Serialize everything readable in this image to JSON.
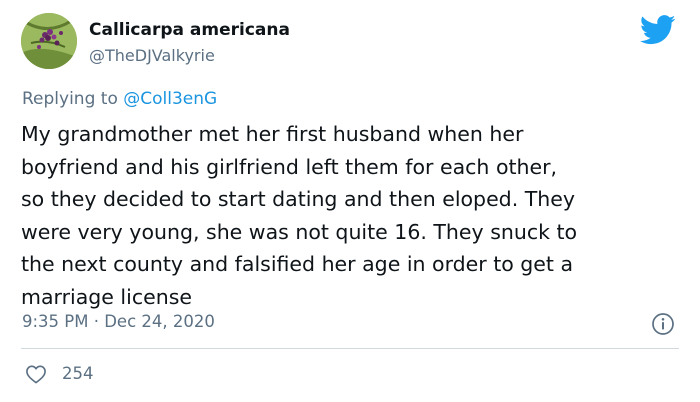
{
  "author": {
    "display_name": "Callicarpa americana",
    "handle": "@TheDJValkyrie"
  },
  "reply_context": {
    "prefix": "Replying to",
    "mention": "@Coll3enG"
  },
  "tweet": {
    "lines": [
      "My grandmother met her first husband when her",
      "boyfriend and his girlfriend left them for each other,",
      "so they decided to start dating and then eloped. They",
      "were very young, she was not quite 16. They snuck to",
      "the next county and falsified her age in order to get a",
      "marriage license"
    ]
  },
  "meta": {
    "timestamp": "9:35 PM · Dec 24, 2020"
  },
  "actions": {
    "like_count": "254"
  },
  "icons": {
    "brand": "twitter-bird-icon",
    "info": "info-icon",
    "like": "heart-icon"
  },
  "colors": {
    "brand_blue": "#1da1f2",
    "mention_blue": "#1b95e0",
    "secondary_text": "#5b7083"
  }
}
